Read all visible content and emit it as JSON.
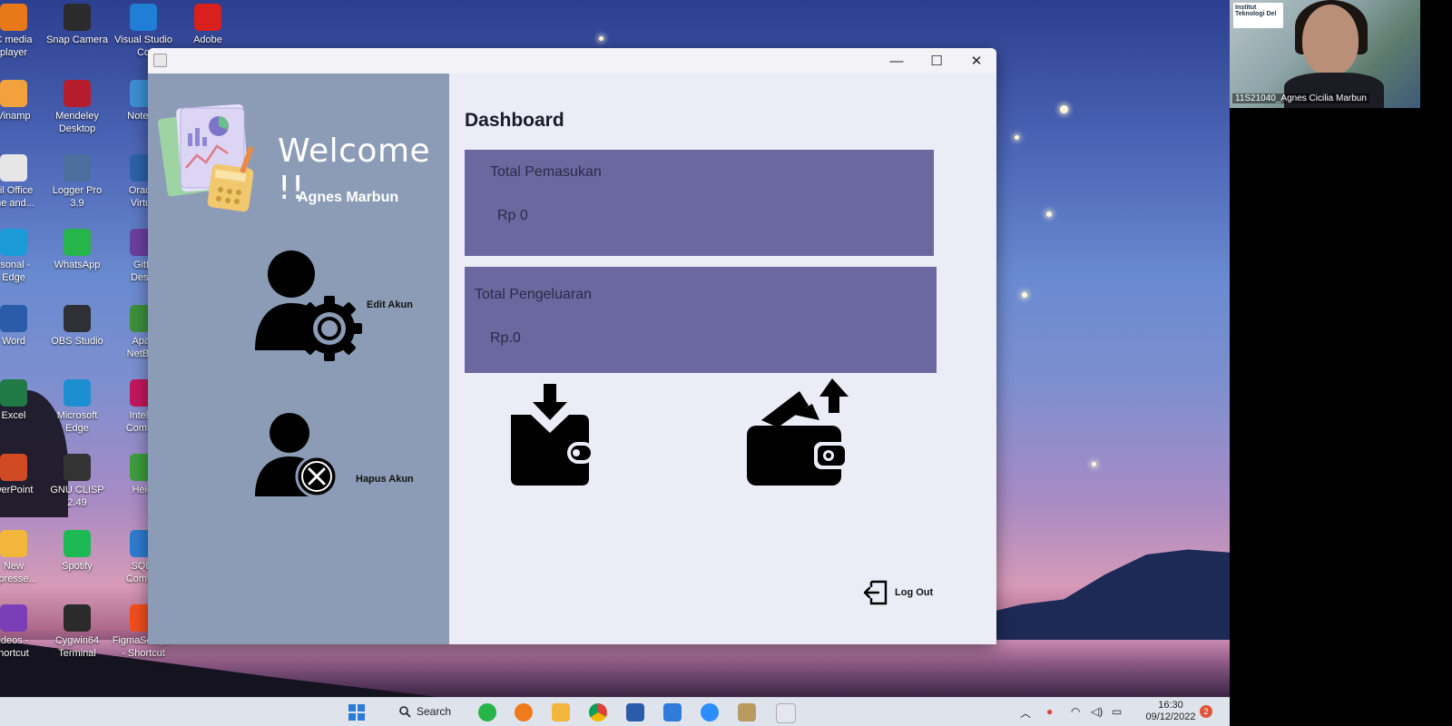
{
  "desktop": {
    "icons": [
      {
        "label": "C media\nplayer",
        "icon": "vlc-icon",
        "color": "#e8781a"
      },
      {
        "label": "Snap Camera",
        "icon": "snap-camera-icon",
        "color": "#2b2b2b"
      },
      {
        "label": "Visual Studio\nCo",
        "icon": "vscode-icon",
        "color": "#1f7fd6"
      },
      {
        "label": "Adobe",
        "icon": "adobe-icon",
        "color": "#d8201d"
      },
      {
        "label": "Vinamp",
        "icon": "winamp-icon",
        "color": "#f2a23c"
      },
      {
        "label": "Mendeley\nDesktop",
        "icon": "mendeley-icon",
        "color": "#b61d2c"
      },
      {
        "label": "Notepa",
        "icon": "notepad-icon",
        "color": "#3d8fd1"
      },
      {
        "label": "ail Office\nme and...",
        "icon": "file-icon",
        "color": "#e6e6e6"
      },
      {
        "label": "Logger Pro\n3.9",
        "icon": "logger-pro-icon",
        "color": "#4b6e9c"
      },
      {
        "label": "Oracle\nVirtua",
        "icon": "virtualbox-icon",
        "color": "#2d62a7"
      },
      {
        "label": "rsonal -\nEdge",
        "icon": "edge-icon",
        "color": "#1a9bd7"
      },
      {
        "label": "WhatsApp",
        "icon": "whatsapp-icon",
        "color": "#25b548"
      },
      {
        "label": "GitH\nDeskt",
        "icon": "github-icon",
        "color": "#6b3fa0"
      },
      {
        "label": "Word",
        "icon": "word-icon",
        "color": "#2a5caa"
      },
      {
        "label": "OBS Studio",
        "icon": "obs-icon",
        "color": "#2f2f36"
      },
      {
        "label": "Apac\nNetBea",
        "icon": "netbeans-icon",
        "color": "#3e8f3e"
      },
      {
        "label": "Excel",
        "icon": "excel-icon",
        "color": "#1f7a46"
      },
      {
        "label": "Microsoft\nEdge",
        "icon": "microsoft-edge-icon",
        "color": "#1d8fd1"
      },
      {
        "label": "IntelliJ\nCommu",
        "icon": "intellij-icon",
        "color": "#c2185b"
      },
      {
        "label": "werPoint",
        "icon": "powerpoint-icon",
        "color": "#d04a23"
      },
      {
        "label": "GNU CLISP\n2.49",
        "icon": "clisp-icon",
        "color": "#333333"
      },
      {
        "label": "Heidi",
        "icon": "heidisql-icon",
        "color": "#3c9d3c"
      },
      {
        "label": "New\nmpresse...",
        "icon": "folder-icon",
        "color": "#f2b63c"
      },
      {
        "label": "Spotify",
        "icon": "spotify-icon",
        "color": "#1db954"
      },
      {
        "label": "SQLy\nCommu",
        "icon": "sqlyog-icon",
        "color": "#2f7bd0"
      },
      {
        "label": "ideos -\nhortcut",
        "icon": "videos-icon",
        "color": "#7a3fb8"
      },
      {
        "label": "Cygwin64\nTerminal",
        "icon": "cygwin-icon",
        "color": "#2b2b2b"
      },
      {
        "label": "FigmaSetup...\n- Shortcut",
        "icon": "figma-icon",
        "color": "#f24e1e"
      }
    ]
  },
  "window": {
    "title": "",
    "controls": {
      "minimize": "—",
      "maximize": "☐",
      "close": "✕"
    }
  },
  "sidebar": {
    "welcome": "Welcome !!",
    "user_name": "Agnes Marbun",
    "edit_account": "Edit Akun",
    "delete_account": "Hapus Akun"
  },
  "dashboard": {
    "title": "Dashboard",
    "income_label": "Total Pemasukan",
    "income_value": "Rp 0",
    "expense_label": "Total Pengeluaran",
    "expense_value": "Rp.0",
    "logout": "Log Out",
    "card_color": "#6a689f"
  },
  "webcam": {
    "caption": "11S21040_Agnes Cicilia Marbun",
    "logo_text": "Institut Teknologi Del"
  },
  "taskbar": {
    "search": "Search",
    "time": "16:30",
    "date": "09/12/2022",
    "notifications": "2"
  }
}
